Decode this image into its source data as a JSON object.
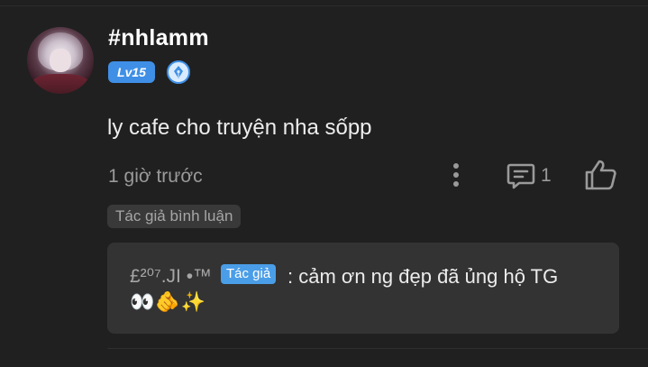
{
  "comment": {
    "username": "#nhlamm",
    "level": "Lv15",
    "text": "ly cafe cho truyện nha sốpp",
    "timestamp": "1 giờ trước",
    "reply_count": "1",
    "author_tag": "Tác giả bình luận"
  },
  "reply": {
    "name": "£²⁰⁷.JI •™",
    "badge": "Tác giả",
    "text": ": cảm ơn ng đẹp đã ủng hộ TG",
    "emoji": "👀🫵✨"
  },
  "icons": {
    "avatar": "avatar-image",
    "pen_badge": "pen-nib-icon",
    "more": "more-vertical-icon",
    "reply": "comment-icon",
    "like": "thumbs-up-icon"
  },
  "colors": {
    "background": "#202020",
    "accent_blue": "#3f8fe6",
    "muted_text": "#9a9a9a",
    "reply_box": "#333333"
  }
}
